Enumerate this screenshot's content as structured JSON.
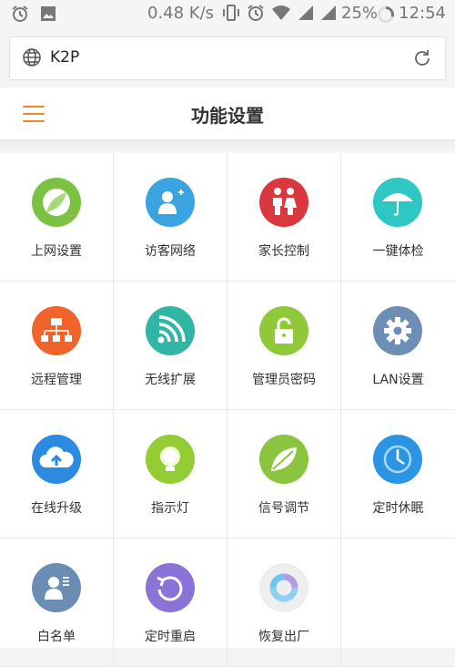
{
  "status_bar": {
    "speed": "0.48 K/s",
    "battery": "25%",
    "time": "12:54"
  },
  "browser": {
    "url": "K2P"
  },
  "header": {
    "title": "功能设置"
  },
  "colors": {
    "accent": "#f08a24",
    "online_setup": "#7cc242",
    "guest_network": "#3aa4e0",
    "parental_control": "#d9393e",
    "one_click_check": "#2fc7c3",
    "remote_management": "#f0642c",
    "wireless_extend": "#31b6a6",
    "admin_password": "#8fc93a",
    "lan_settings": "#6d8fb5",
    "online_upgrade": "#2c8be0",
    "indicator_light": "#93cc35",
    "signal_adjust": "#8bc540",
    "timed_sleep": "#2b95e3",
    "whitelist": "#6c8db3",
    "timed_reboot": "#8b72d6",
    "factory_reset": "#eeeeee"
  },
  "grid": {
    "items": [
      {
        "label": "上网设置",
        "icon": "globe-leaf-icon"
      },
      {
        "label": "访客网络",
        "icon": "guest-user-icon"
      },
      {
        "label": "家长控制",
        "icon": "parent-child-icon"
      },
      {
        "label": "一键体检",
        "icon": "umbrella-icon"
      },
      {
        "label": "远程管理",
        "icon": "network-tree-icon"
      },
      {
        "label": "无线扩展",
        "icon": "wifi-signal-icon"
      },
      {
        "label": "管理员密码",
        "icon": "lock-icon"
      },
      {
        "label": "LAN设置",
        "icon": "gear-icon"
      },
      {
        "label": "在线升级",
        "icon": "cloud-upload-icon"
      },
      {
        "label": "指示灯",
        "icon": "lightbulb-icon"
      },
      {
        "label": "信号调节",
        "icon": "leaf-icon"
      },
      {
        "label": "定时休眠",
        "icon": "clock-icon"
      },
      {
        "label": "白名单",
        "icon": "user-list-icon"
      },
      {
        "label": "定时重启",
        "icon": "restart-icon"
      },
      {
        "label": "恢复出厂",
        "icon": "ring-reset-icon"
      }
    ]
  }
}
